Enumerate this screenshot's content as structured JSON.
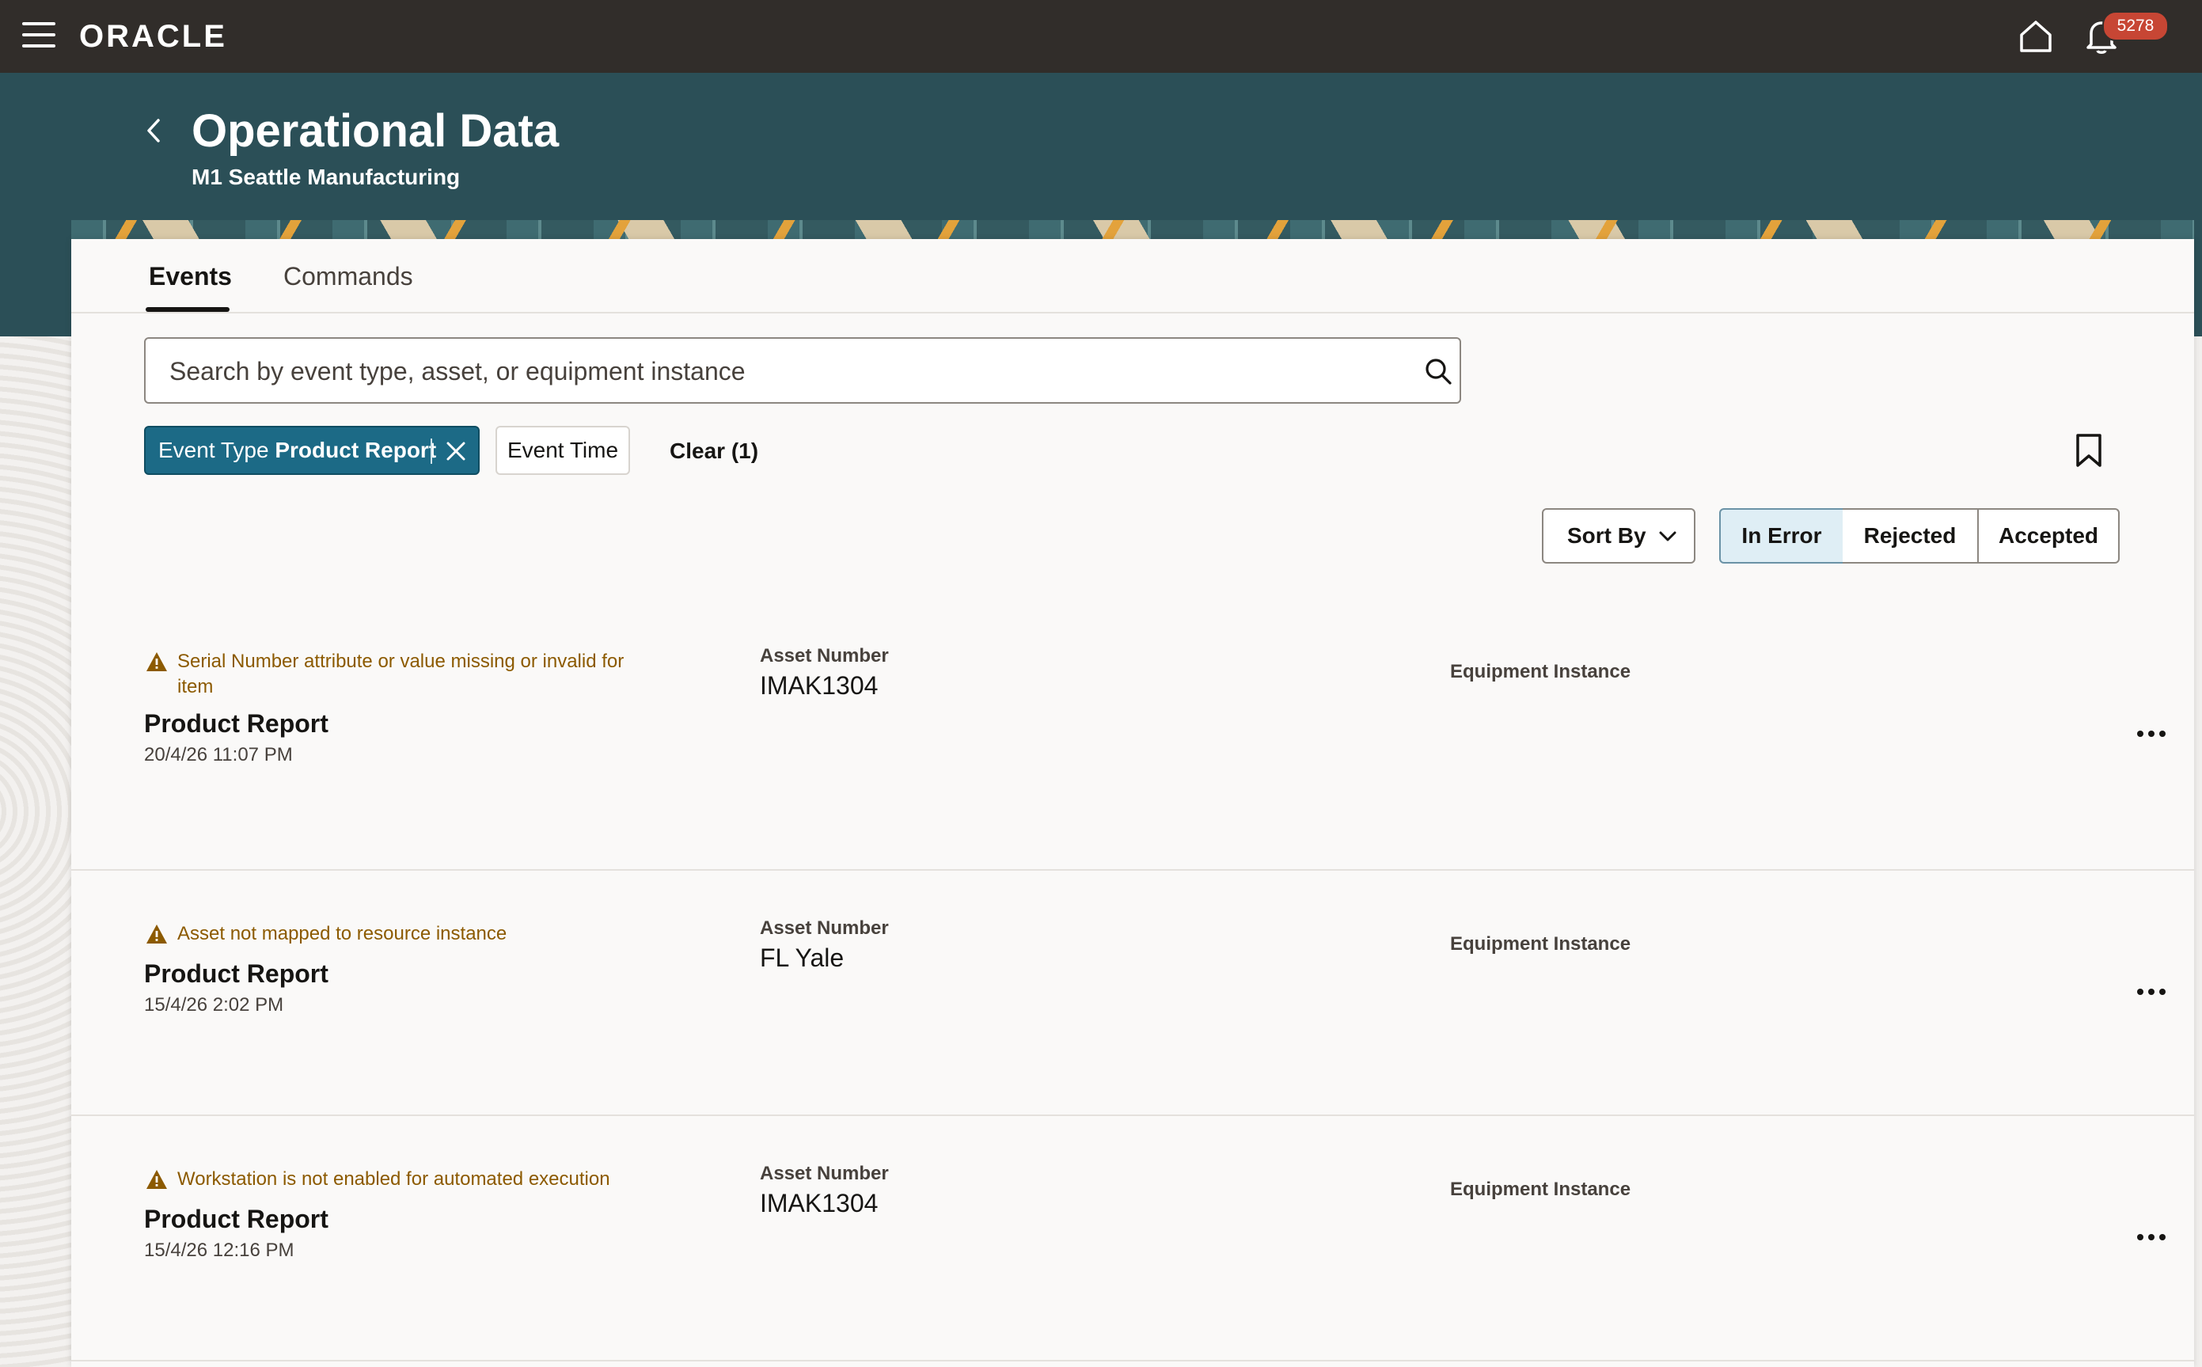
{
  "topbar": {
    "brand": "ORACLE",
    "notification_count": "5278"
  },
  "header": {
    "title": "Operational Data",
    "subtitle": "M1 Seattle Manufacturing"
  },
  "tabs": [
    {
      "label": "Events",
      "active": true
    },
    {
      "label": "Commands",
      "active": false
    }
  ],
  "search": {
    "placeholder": "Search by event type, asset, or equipment instance"
  },
  "filters": {
    "active_chip_prefix": "Event Type",
    "active_chip_value": "Product Report",
    "event_time_chip": "Event Time",
    "clear_label": "Clear (1)"
  },
  "toolbar": {
    "sort_by": "Sort By",
    "segments": [
      {
        "label": "In Error",
        "selected": true
      },
      {
        "label": "Rejected",
        "selected": false
      },
      {
        "label": "Accepted",
        "selected": false
      }
    ]
  },
  "events": [
    {
      "error": "Serial Number attribute or value missing or invalid for item",
      "title": "Product Report",
      "date": "20/4/26 11:07 PM",
      "asset_label": "Asset Number",
      "asset_value": "IMAK1304",
      "equipment_label": "Equipment Instance"
    },
    {
      "error": "Asset not mapped to resource instance",
      "title": "Product Report",
      "date": "15/4/26 2:02 PM",
      "asset_label": "Asset Number",
      "asset_value": "FL Yale",
      "equipment_label": "Equipment Instance"
    },
    {
      "error": "Workstation is not enabled for automated execution",
      "title": "Product Report",
      "date": "15/4/26 12:16 PM",
      "asset_label": "Asset Number",
      "asset_value": "IMAK1304",
      "equipment_label": "Equipment Instance"
    }
  ],
  "colors": {
    "topbar": "#312d2a",
    "header": "#2b4f57",
    "chip_active": "#1c6a86",
    "error_text": "#8c5a00",
    "badge": "#c74634"
  },
  "icons": [
    "menu-icon",
    "home-icon",
    "bell-icon",
    "back-icon",
    "search-icon",
    "close-icon",
    "bookmark-icon",
    "chevron-down-icon",
    "warning-icon",
    "more-icon"
  ]
}
